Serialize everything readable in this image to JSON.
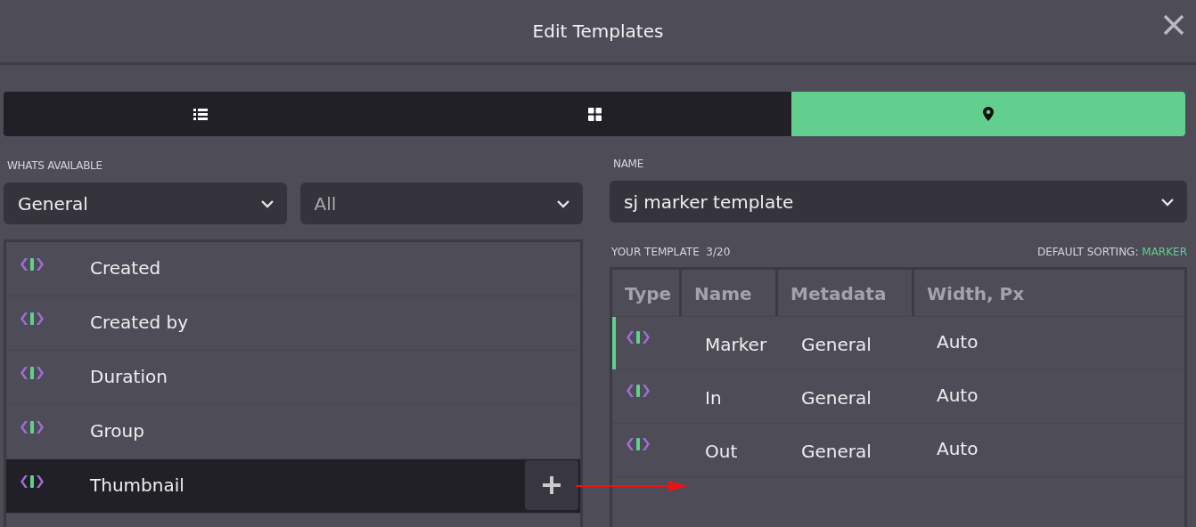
{
  "window": {
    "title": "Edit Templates"
  },
  "view_tabs": [
    {
      "kind": "list",
      "selected": false
    },
    {
      "kind": "grid",
      "selected": false
    },
    {
      "kind": "pin",
      "selected": true
    }
  ],
  "available": {
    "label": "WHATS AVAILABLE",
    "category": "General",
    "filter": "All",
    "items": [
      {
        "name": "Created",
        "selected": false
      },
      {
        "name": "Created by",
        "selected": false
      },
      {
        "name": "Duration",
        "selected": false
      },
      {
        "name": "Group",
        "selected": false
      },
      {
        "name": "Thumbnail",
        "selected": true
      }
    ]
  },
  "template": {
    "name_label": "NAME",
    "name": "sj marker template",
    "title": "YOUR TEMPLATE",
    "count": "3/20",
    "sorting_label": "DEFAULT SORTING:",
    "sorting_value": "MARKER",
    "columns": [
      "Type",
      "Name",
      "Metadata",
      "Width, Px"
    ],
    "rows": [
      {
        "name": "Marker",
        "metadata": "General",
        "width": "Auto",
        "selected": true
      },
      {
        "name": "In",
        "metadata": "General",
        "width": "Auto",
        "selected": false
      },
      {
        "name": "Out",
        "metadata": "General",
        "width": "Auto",
        "selected": false
      }
    ]
  }
}
